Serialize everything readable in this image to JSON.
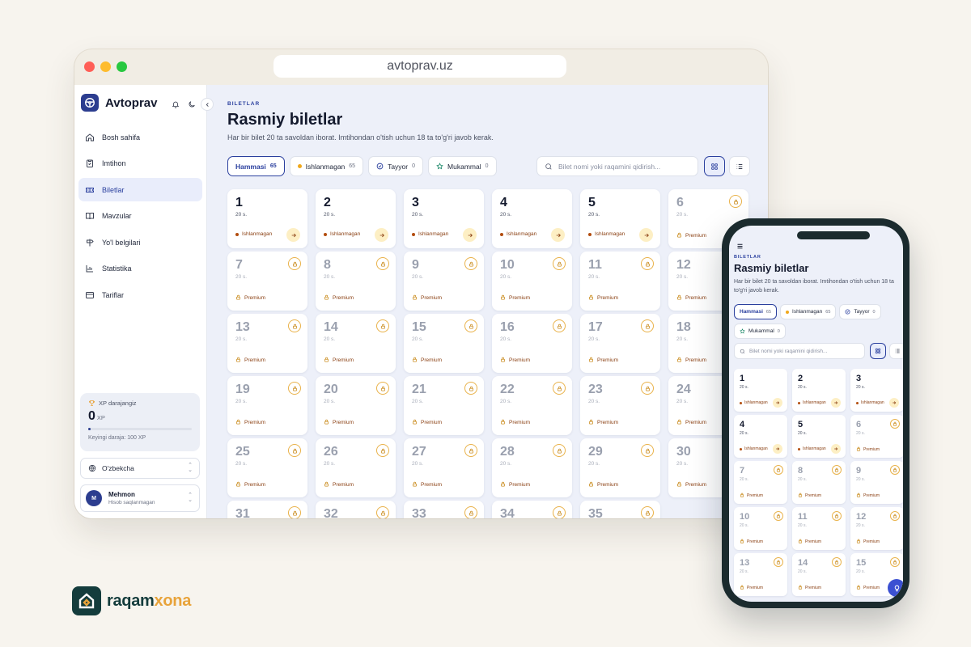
{
  "browser": {
    "url": "avtoprav.uz"
  },
  "app": {
    "name": "Avtoprav"
  },
  "sidebar": {
    "items": [
      {
        "label": "Bosh sahifa",
        "icon": "home-icon"
      },
      {
        "label": "Imtihon",
        "icon": "clipboard-icon"
      },
      {
        "label": "Biletlar",
        "icon": "ticket-icon",
        "active": true
      },
      {
        "label": "Mavzular",
        "icon": "book-icon"
      },
      {
        "label": "Yo'l belgilari",
        "icon": "signpost-icon"
      },
      {
        "label": "Statistika",
        "icon": "chart-icon"
      },
      {
        "label": "Tariflar",
        "icon": "card-icon"
      }
    ],
    "xp": {
      "label": "XP darajangiz",
      "value": "0",
      "unit": "XP",
      "progress": 0,
      "next": "Keyingi daraja: 100 XP"
    },
    "language": "O'zbekcha",
    "user": {
      "initial": "M",
      "name": "Mehmon",
      "status": "Hisob saqlanmagan"
    }
  },
  "main": {
    "eyebrow": "BILETLAR",
    "title": "Rasmiy biletlar",
    "description": "Har bir bilet 20 ta savoldan iborat. Imtihondan o'tish uchun 18 ta to'g'ri javob kerak.",
    "filters": [
      {
        "label": "Hammasi",
        "count": "65",
        "active": true
      },
      {
        "label": "Ishlanmagan",
        "count": "65",
        "icon": "orange-dot"
      },
      {
        "label": "Tayyor",
        "count": "0",
        "icon": "check-circle-icon"
      },
      {
        "label": "Mukammal",
        "count": "0",
        "icon": "star-icon"
      }
    ],
    "search_placeholder": "Bilet nomi yoki raqamini qidirish...",
    "questions_label": "20 s.",
    "status_unlocked": "Ishlanmagan",
    "status_locked": "Premium",
    "desktop_tickets": [
      "1",
      "2",
      "3",
      "4",
      "5",
      "6",
      "7",
      "8",
      "9",
      "10",
      "11",
      "12",
      "13",
      "14",
      "15",
      "16",
      "17",
      "18",
      "19",
      "20",
      "21",
      "22",
      "23",
      "24",
      "25",
      "26",
      "27",
      "28",
      "29",
      "30",
      "31",
      "32",
      "33",
      "34",
      "35"
    ],
    "unlocked_count": 5,
    "phone_tickets": [
      "1",
      "2",
      "3",
      "4",
      "5",
      "6",
      "7",
      "8",
      "9",
      "10",
      "11",
      "12",
      "13",
      "14",
      "15"
    ]
  },
  "colors": {
    "brand": "#2c3d8f",
    "accent_orange": "#f0a81c",
    "locked_ring": "#e9b24a",
    "background": "#edf0f9"
  },
  "footer": {
    "brand_part1": "raqam",
    "brand_part2": "xona"
  }
}
